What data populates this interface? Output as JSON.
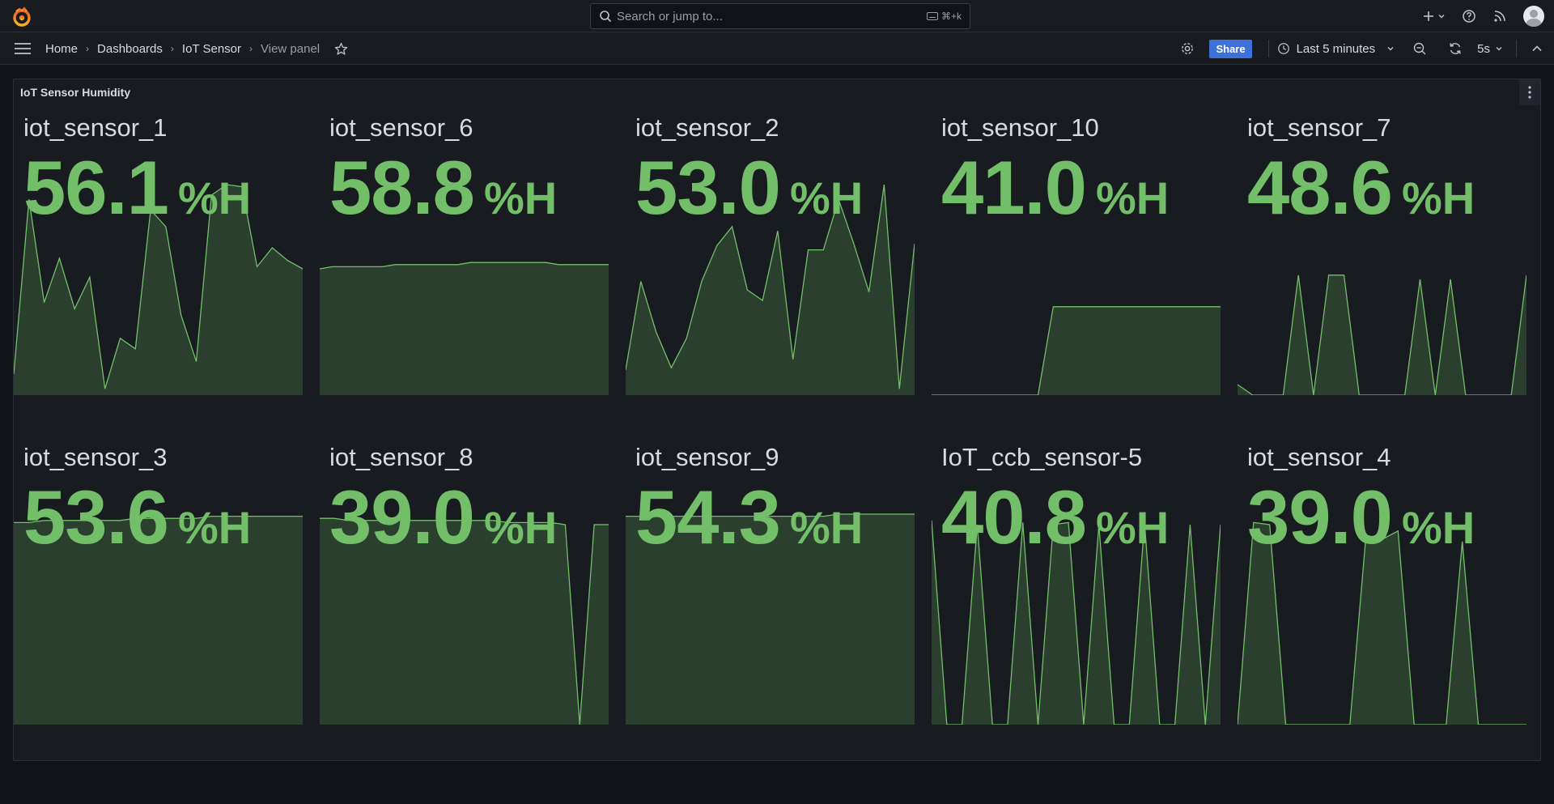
{
  "search": {
    "placeholder": "Search or jump to...",
    "shortcut": "⌘+k"
  },
  "breadcrumb": [
    "Home",
    "Dashboards",
    "IoT Sensor",
    "View panel"
  ],
  "toolbar": {
    "share_label": "Share",
    "time_range": "Last 5 minutes",
    "refresh_interval": "5s"
  },
  "panel": {
    "title": "IoT Sensor Humidity",
    "unit": "%H",
    "color": "#73bf69",
    "tiles": [
      {
        "name": "iot_sensor_1",
        "value": "56.1",
        "spark": [
          0.1,
          0.93,
          0.44,
          0.65,
          0.41,
          0.56,
          0.03,
          0.27,
          0.22,
          0.88,
          0.8,
          0.38,
          0.16,
          0.95,
          1.0,
          0.99,
          0.61,
          0.7,
          0.64,
          0.6
        ]
      },
      {
        "name": "iot_sensor_6",
        "value": "58.8",
        "spark": [
          0.6,
          0.61,
          0.61,
          0.61,
          0.61,
          0.61,
          0.62,
          0.62,
          0.62,
          0.62,
          0.62,
          0.62,
          0.63,
          0.63,
          0.63,
          0.63,
          0.63,
          0.63,
          0.63,
          0.62,
          0.62,
          0.62,
          0.62,
          0.62
        ]
      },
      {
        "name": "iot_sensor_2",
        "value": "53.0",
        "spark": [
          0.12,
          0.54,
          0.3,
          0.13,
          0.27,
          0.54,
          0.71,
          0.8,
          0.5,
          0.45,
          0.78,
          0.17,
          0.69,
          0.69,
          0.93,
          0.72,
          0.49,
          1.0,
          0.03,
          0.72
        ]
      },
      {
        "name": "iot_sensor_10",
        "value": "41.0",
        "spark": [
          0,
          0,
          0,
          0,
          0,
          0,
          0,
          0,
          0.42,
          0.42,
          0.42,
          0.42,
          0.42,
          0.42,
          0.42,
          0.42,
          0.42,
          0.42,
          0.42,
          0.42
        ]
      },
      {
        "name": "iot_sensor_7",
        "value": "48.6",
        "spark": [
          0.05,
          0,
          0,
          0,
          0.57,
          0,
          0.57,
          0.57,
          0,
          0,
          0,
          0,
          0.55,
          0,
          0.55,
          0,
          0,
          0,
          0,
          0.57
        ]
      },
      {
        "name": "iot_sensor_3",
        "value": "53.6",
        "spark": [
          0.96,
          0.96,
          0.97,
          0.97,
          0.97,
          0.97,
          0.97,
          0.97,
          0.98,
          0.98,
          0.98,
          0.98,
          0.98,
          0.99,
          0.99,
          0.99,
          0.99,
          0.99,
          0.99,
          0.99
        ]
      },
      {
        "name": "iot_sensor_8",
        "value": "39.0",
        "spark": [
          0.98,
          0.98,
          0.97,
          0.97,
          0.97,
          0.97,
          0.97,
          0.97,
          0.97,
          0.97,
          0.97,
          0.97,
          0.97,
          0.96,
          0.96,
          0.96,
          0.96,
          0.95,
          0.0,
          0.95,
          0.95
        ]
      },
      {
        "name": "iot_sensor_9",
        "value": "54.3",
        "spark": [
          0.99,
          0.99,
          0.99,
          0.99,
          0.99,
          0.99,
          0.99,
          0.99,
          0.99,
          0.99,
          0.99,
          0.99,
          0.99,
          0.99,
          1.0,
          1.0,
          1.0,
          1.0,
          1.0,
          1.0
        ]
      },
      {
        "name": "IoT_ccb_sensor-5",
        "value": "40.8",
        "spark": [
          0.97,
          0,
          0,
          0.95,
          0,
          0,
          0.96,
          0,
          0.95,
          0.96,
          0,
          0.95,
          0,
          0,
          0.96,
          0,
          0,
          0.95,
          0,
          0.95
        ]
      },
      {
        "name": "iot_sensor_4",
        "value": "39.0",
        "spark": [
          0,
          0.96,
          0.95,
          0,
          0,
          0,
          0,
          0,
          0.9,
          0.88,
          0.92,
          0,
          0,
          0,
          0.87,
          0,
          0,
          0,
          0
        ]
      }
    ]
  }
}
